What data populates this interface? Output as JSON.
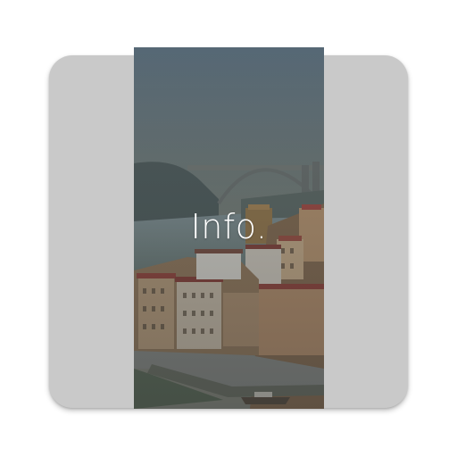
{
  "app_icon": {
    "label": "Info.",
    "tile_color": "#c9c9c9",
    "photo_subject": "city-riverside-bridge-photo"
  }
}
